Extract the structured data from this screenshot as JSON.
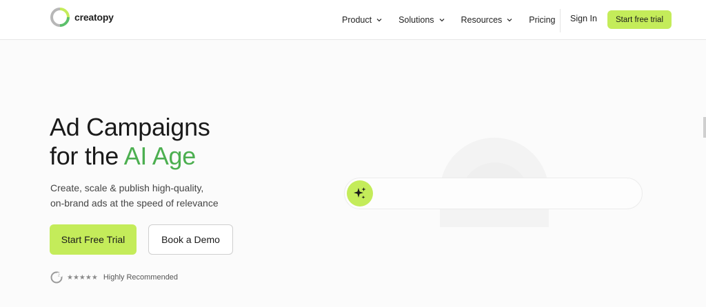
{
  "header": {
    "logo_text": "creatopy",
    "nav": [
      {
        "label": "Product",
        "has_dropdown": true
      },
      {
        "label": "Solutions",
        "has_dropdown": true
      },
      {
        "label": "Resources",
        "has_dropdown": true
      },
      {
        "label": "Pricing",
        "has_dropdown": false
      }
    ],
    "signin_label": "Sign In",
    "trial_label": "Start free trial"
  },
  "hero": {
    "title_line1": "Ad Campaigns",
    "title_line2_prefix": "for the ",
    "title_line2_accent": "AI Age",
    "subtitle_line1": "Create, scale & publish high-quality,",
    "subtitle_line2": "on-brand ads at the speed of relevance",
    "primary_cta": "Start Free Trial",
    "secondary_cta": "Book a Demo",
    "rating_stars": "★★★★★",
    "rating_label": "Highly Recommended"
  },
  "prompt": {
    "icon": "sparkles-icon"
  },
  "colors": {
    "accent_lime": "#c4ec5a",
    "accent_green": "#4caf50"
  }
}
